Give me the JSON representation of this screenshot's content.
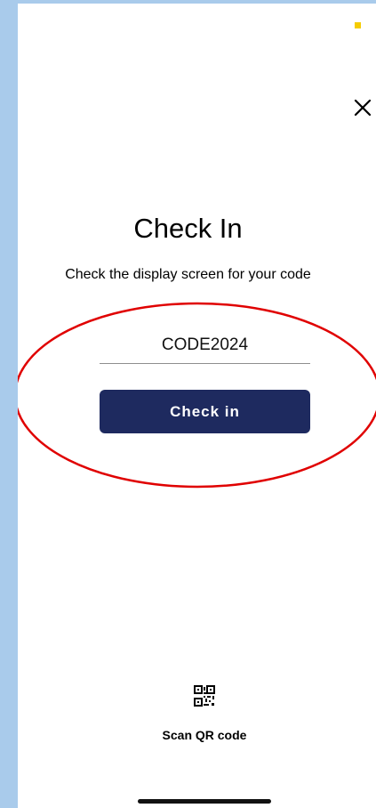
{
  "header": {
    "close_icon": "close-icon",
    "status_indicator_color": "#f5cc00"
  },
  "checkin": {
    "title": "Check In",
    "subtitle": "Check the display screen for your code",
    "code_value": "CODE2024",
    "button_label": "Check in"
  },
  "footer": {
    "qr_icon": "qr-code-icon",
    "qr_label": "Scan QR code"
  },
  "colors": {
    "accent": "#1e2a5f",
    "annotation": "#e00000",
    "background": "#a9cbeb"
  }
}
